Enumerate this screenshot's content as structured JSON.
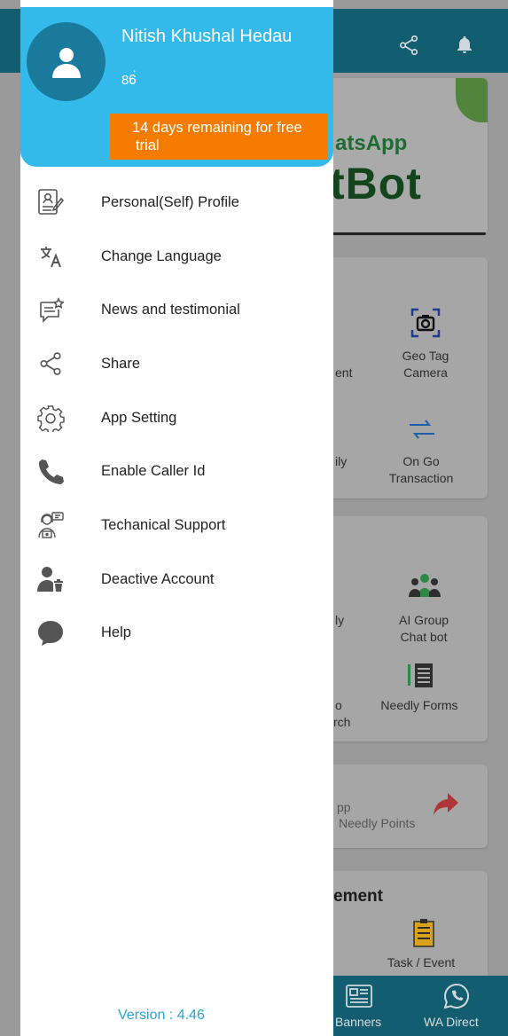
{
  "background": {
    "banner_line1": "atsApp",
    "banner_line2": "tBot",
    "tiles": [
      {
        "icon": "camera-icon",
        "label_1": "Geo Tag",
        "label_2": "Camera"
      },
      {
        "icon": "transfer-icon",
        "label_1": "On Go",
        "label_2": "Transaction"
      },
      {
        "icon": "group-icon",
        "label_1": "AI Group",
        "label_2": "Chat bot"
      },
      {
        "icon": "forms-icon",
        "label_1": "Needly Forms",
        "label_2": ""
      },
      {
        "icon": "task-icon",
        "label_1": "Task / Event",
        "label_2": ""
      }
    ],
    "partial_texts": [
      "ent",
      "ily",
      "ly",
      "o",
      "rch",
      "pp"
    ],
    "points_label": "Needly Points",
    "section_heading": "ement",
    "bottom_nav": [
      "Banners",
      "WA Direct"
    ]
  },
  "drawer": {
    "user_name": "Nitish Khushal Hedau",
    "user_phone": "86่",
    "trial_text_line1": "14 days remaining for free",
    "trial_text_line2": "trial",
    "menu": [
      {
        "label": "Personal(Self) Profile",
        "icon": "profile-icon"
      },
      {
        "label": "Change Language",
        "icon": "translate-icon"
      },
      {
        "label": "News and testimonial",
        "icon": "news-icon"
      },
      {
        "label": "Share",
        "icon": "share-icon"
      },
      {
        "label": "App Setting",
        "icon": "gear-icon"
      },
      {
        "label": "Enable Caller Id",
        "icon": "phone-icon"
      },
      {
        "label": "Techanical Support",
        "icon": "support-icon"
      },
      {
        "label": "Deactive Account",
        "icon": "user-delete-icon"
      },
      {
        "label": "Help",
        "icon": "chat-bubble-icon"
      }
    ],
    "version": "Version :  4.46"
  },
  "colors": {
    "header_bg": "#34b9eb",
    "trial_bg": "#f57c00",
    "version_text": "#29a3d1",
    "topbar_bg": "#135d70"
  }
}
